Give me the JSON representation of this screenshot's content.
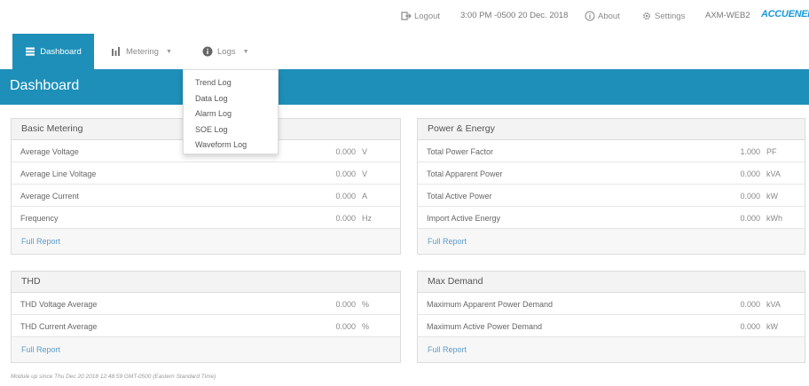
{
  "topbar": {
    "logout_label": "Logout",
    "datetime": "3:00 PM -0500 20 Dec. 2018",
    "about_label": "About",
    "settings_label": "Settings",
    "device": "AXM-WEB2",
    "brand": "ACCUENERGY"
  },
  "nav": {
    "dashboard": "Dashboard",
    "metering": "Metering",
    "logs": "Logs"
  },
  "logs_menu": [
    "Trend Log",
    "Data Log",
    "Alarm Log",
    "SOE Log",
    "Waveform Log"
  ],
  "page_title": "Dashboard",
  "panels": {
    "basic": {
      "title": "Basic Metering",
      "rows": [
        {
          "label": "Average Voltage",
          "value": "0.000",
          "unit": "V"
        },
        {
          "label": "Average Line Voltage",
          "value": "0.000",
          "unit": "V"
        },
        {
          "label": "Average Current",
          "value": "0.000",
          "unit": "A"
        },
        {
          "label": "Frequency",
          "value": "0.000",
          "unit": "Hz"
        }
      ],
      "report": "Full Report"
    },
    "power": {
      "title": "Power & Energy",
      "rows": [
        {
          "label": "Total Power Factor",
          "value": "1.000",
          "unit": "PF"
        },
        {
          "label": "Total Apparent Power",
          "value": "0.000",
          "unit": "kVA"
        },
        {
          "label": "Total Active Power",
          "value": "0.000",
          "unit": "kW"
        },
        {
          "label": "Import Active Energy",
          "value": "0.000",
          "unit": "kWh"
        }
      ],
      "report": "Full Report"
    },
    "thd": {
      "title": "THD",
      "rows": [
        {
          "label": "THD Voltage Average",
          "value": "0.000",
          "unit": "%"
        },
        {
          "label": "THD Current Average",
          "value": "0.000",
          "unit": "%"
        }
      ],
      "report": "Full Report"
    },
    "demand": {
      "title": "Max Demand",
      "rows": [
        {
          "label": "Maximum Apparent Power Demand",
          "value": "0.000",
          "unit": "kVA"
        },
        {
          "label": "Maximum Active Power Demand",
          "value": "0.000",
          "unit": "kW"
        }
      ],
      "report": "Full Report"
    }
  },
  "footer": "Module up since Thu Dec 20 2018 12:48:59 GMT-0500 (Eastern Standard Time)",
  "colors": {
    "accent": "#1d8fb8",
    "link": "#5d9cc8",
    "brand": "#1a9ad6"
  }
}
